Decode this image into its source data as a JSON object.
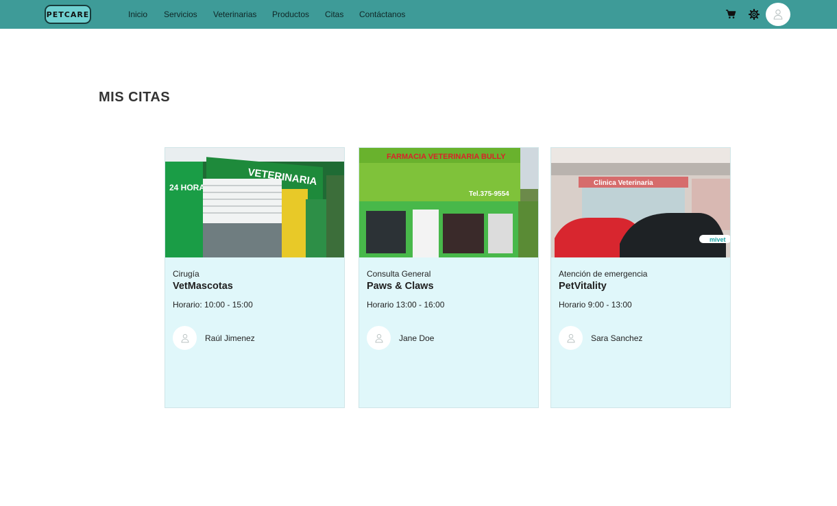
{
  "navbar": {
    "logo_text": "PETCARE",
    "links": [
      "Inicio",
      "Servicios",
      "Veterinarias",
      "Productos",
      "Citas",
      "Contáctanos"
    ],
    "icons": [
      "cart-icon",
      "settings-icon",
      "user-avatar-icon"
    ]
  },
  "page": {
    "title": "MIS CITAS"
  },
  "appointments": [
    {
      "type": "Cirugía",
      "clinic": "VetMascotas",
      "hours": "Horario: 10:00 - 15:00",
      "person": "Raúl Jimenez",
      "image_sign": "VETERINARIA",
      "image_badge": "24 HORAS"
    },
    {
      "type": "Consulta General",
      "clinic": "Paws & Claws",
      "hours": "Horario 13:00 - 16:00",
      "person": "Jane Doe",
      "image_sign": "FARMACIA VETERINARIA BULLY",
      "image_badge": "Tel.375-9554"
    },
    {
      "type": "Atención de emergencia",
      "clinic": "PetVitality",
      "hours": "Horario 9:00 - 13:00",
      "person": "Sara Sanchez",
      "image_sign": "Clinica Veterinaria",
      "image_badge": "mivet"
    }
  ],
  "colors": {
    "navbar": "#3e9b98",
    "card_background": "#e0f7fa",
    "logo_background": "#6fd0d0"
  }
}
